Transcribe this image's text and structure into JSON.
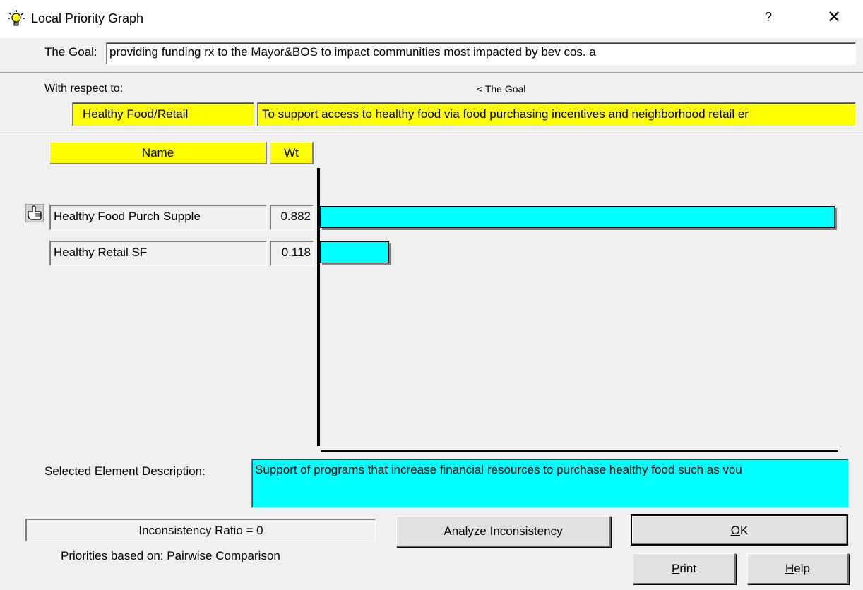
{
  "window": {
    "title": "Local Priority Graph",
    "help_label": "?",
    "close_label": "✕"
  },
  "goal": {
    "label": "The Goal:",
    "text": "providing funding rx to the Mayor&BOS to impact communities most impacted by bev cos. a"
  },
  "respect": {
    "label": "With respect to:",
    "path": "< The Goal",
    "node_name": "Healthy Food/Retail",
    "node_description": "To support access to healthy food via food purchasing incentives and neighborhood retail er"
  },
  "table": {
    "name_header": "Name",
    "wt_header": "Wt",
    "pointer_icon": "hand-pointer-icon"
  },
  "chart_data": {
    "type": "bar",
    "categories": [
      "Healthy Food Purch Supple",
      "Healthy Retail SF"
    ],
    "values": [
      0.882,
      0.118
    ],
    "value_labels": [
      "0.882",
      "0.118"
    ],
    "xlim": [
      0,
      0.882
    ],
    "bar_color": "#00ffff",
    "selected_index": 0
  },
  "description": {
    "label": "Selected Element Description:",
    "text": "Support of programs that increase financial resources to purchase healthy food such as vou"
  },
  "status": {
    "inconsistency": "Inconsistency Ratio = 0",
    "priorities_basis": "Priorities based on:  Pairwise Comparison"
  },
  "buttons": {
    "analyze": {
      "pre": "",
      "key": "A",
      "post": "nalyze Inconsistency"
    },
    "ok": {
      "pre": "",
      "key": "O",
      "post": "K"
    },
    "print": {
      "pre": "",
      "key": "P",
      "post": "rint"
    },
    "help": {
      "pre": "",
      "key": "H",
      "post": "elp"
    }
  }
}
